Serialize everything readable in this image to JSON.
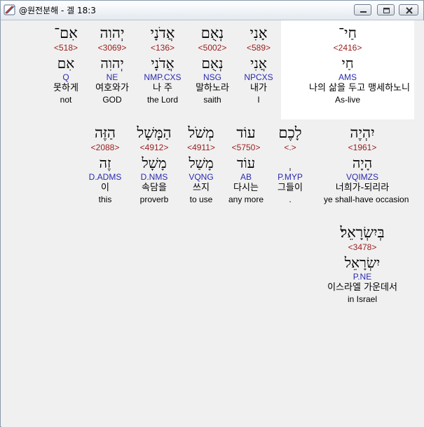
{
  "window": {
    "title": "@원전분해 - 겔 18:3"
  },
  "rows": [
    [
      {
        "heb": "חַי־",
        "strong": "<2416>",
        "lemma": "חַי",
        "morph": "AMS",
        "kor": "나의 삶을 두고 맹세하노니",
        "eng": "As-live"
      },
      {
        "heb": "אָנִי",
        "strong": "<589>",
        "lemma": "אֲנִי",
        "morph": "NPCXS",
        "kor": "내가",
        "eng": "I"
      },
      {
        "heb": "נְאֻם",
        "strong": "<5002>",
        "lemma": "נְאֻם",
        "morph": "NSG",
        "kor": "말하노라",
        "eng": "saith"
      },
      {
        "heb": "אֲדֹנָי",
        "strong": "<136>",
        "lemma": "אֲדֹנָי",
        "morph": "NMP.CXS",
        "kor": "나 주",
        "eng": "the Lord"
      },
      {
        "heb": "יְהוִה",
        "strong": "<3069>",
        "lemma": "יְהוִה",
        "morph": "NE",
        "kor": "여호와가",
        "eng": "GOD"
      },
      {
        "heb": "אִם־",
        "strong": "<518>",
        "lemma": "אִם",
        "morph": "Q",
        "kor": "못하게",
        "eng": "not"
      }
    ],
    [
      {
        "heb": "יִהְיֶה",
        "strong": "<1961>",
        "lemma": "הָיָה",
        "morph": "VQIMZS",
        "kor": "너희가-되리라",
        "eng": "ye shall-have occasion"
      },
      {
        "heb": "לָכֶם",
        "strong": "<.>",
        "lemma": "ְ",
        "morph": "P.MYP",
        "kor": "그들이",
        "eng": "."
      },
      {
        "heb": "עוֹד",
        "strong": "<5750>",
        "lemma": "עוֹד",
        "morph": "AB",
        "kor": "다시는",
        "eng": "any more"
      },
      {
        "heb": "מְשֹׁל",
        "strong": "<4911>",
        "lemma": "מָשַׁל",
        "morph": "VQNG",
        "kor": "쓰지",
        "eng": "to use"
      },
      {
        "heb": "הַמָּשָׁל",
        "strong": "<4912>",
        "lemma": "מָשָׁל",
        "morph": "D.NMS",
        "kor": "속담을",
        "eng": "proverb"
      },
      {
        "heb": "הַזֶּה",
        "strong": "<2088>",
        "lemma": "זֶה",
        "morph": "D.ADMS",
        "kor": "이",
        "eng": "this"
      }
    ],
    [
      {
        "heb": "בְּיִשְׂרָאֵל׃",
        "strong": "<3478>",
        "lemma": "יִשְׂרָאֵל",
        "morph": "P.NE",
        "kor": "이스라엘 가운데서",
        "eng": "in Israel"
      }
    ]
  ],
  "colors": {
    "strong": "#9b1c1c",
    "morph": "#2a2ab0",
    "highlight": "#ffffff"
  }
}
